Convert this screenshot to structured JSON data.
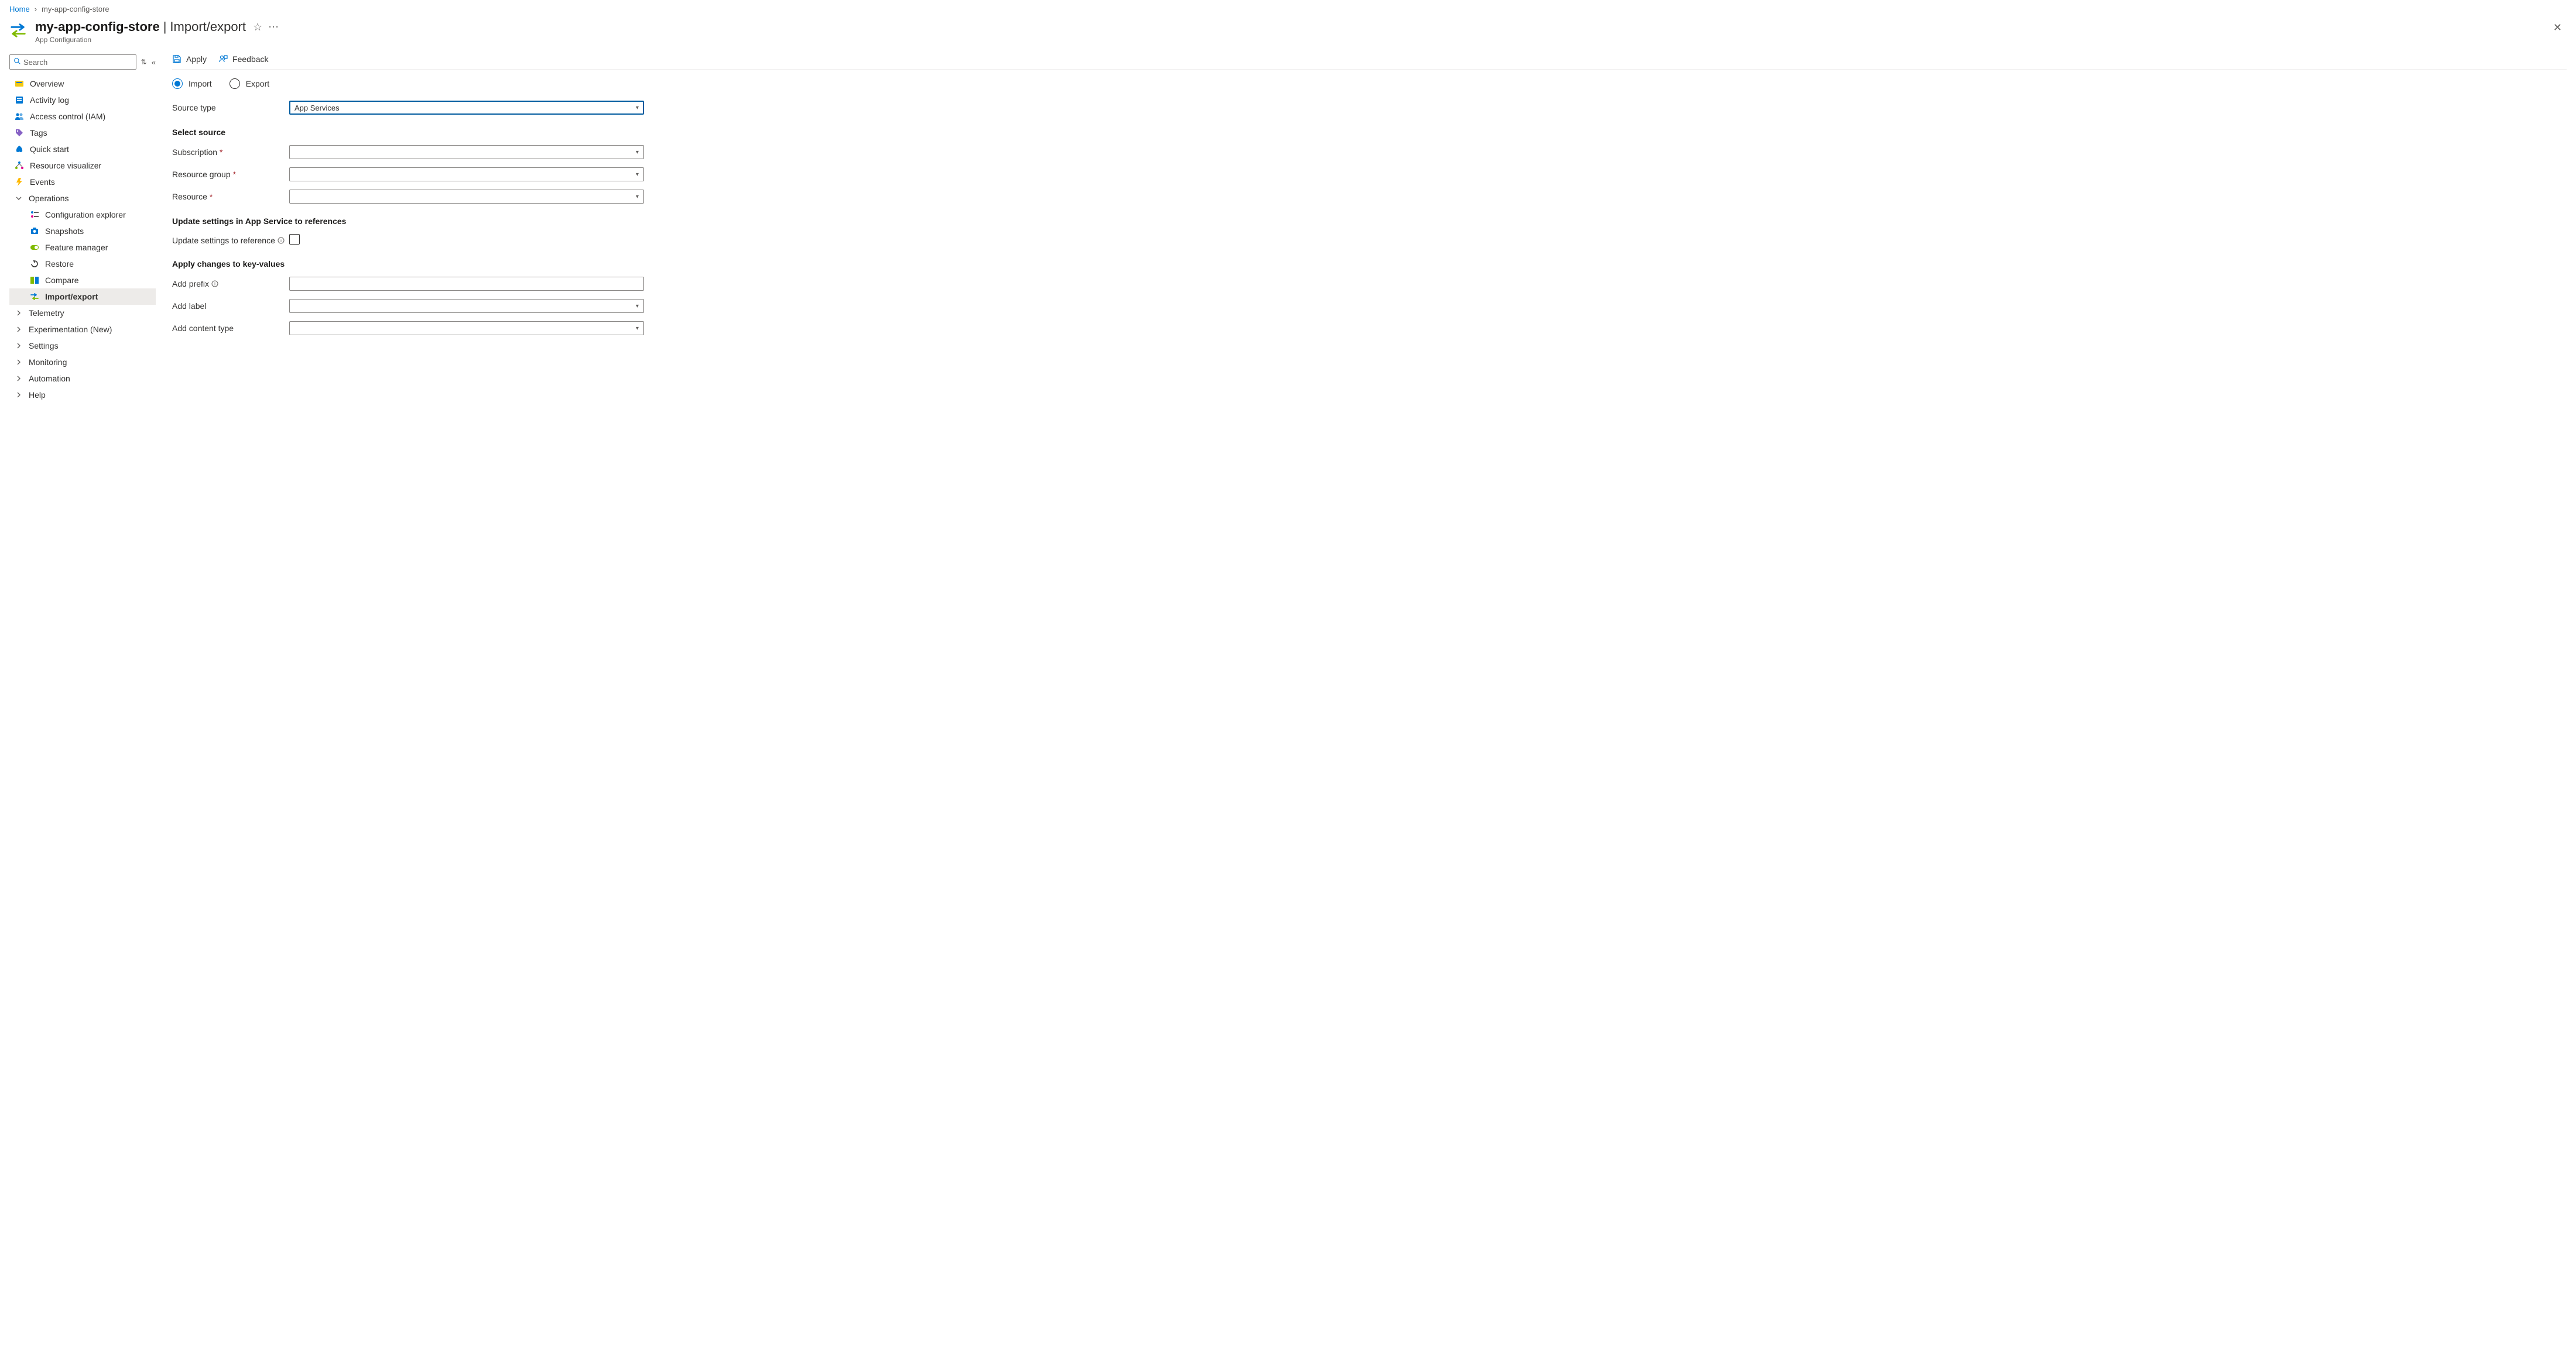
{
  "breadcrumb": {
    "home": "Home",
    "current": "my-app-config-store"
  },
  "header": {
    "resource_name": "my-app-config-store",
    "page_name": "Import/export",
    "sub": "App Configuration"
  },
  "search": {
    "placeholder": "Search"
  },
  "sidebar": {
    "items": [
      {
        "label": "Overview"
      },
      {
        "label": "Activity log"
      },
      {
        "label": "Access control (IAM)"
      },
      {
        "label": "Tags"
      },
      {
        "label": "Quick start"
      },
      {
        "label": "Resource visualizer"
      },
      {
        "label": "Events"
      },
      {
        "label": "Operations",
        "expanded": true
      },
      {
        "label": "Configuration explorer"
      },
      {
        "label": "Snapshots"
      },
      {
        "label": "Feature manager"
      },
      {
        "label": "Restore"
      },
      {
        "label": "Compare"
      },
      {
        "label": "Import/export"
      },
      {
        "label": "Telemetry"
      },
      {
        "label": "Experimentation (New)"
      },
      {
        "label": "Settings"
      },
      {
        "label": "Monitoring"
      },
      {
        "label": "Automation"
      },
      {
        "label": "Help"
      }
    ]
  },
  "toolbar": {
    "apply": "Apply",
    "feedback": "Feedback"
  },
  "radio": {
    "import": "Import",
    "export": "Export",
    "selected": "import"
  },
  "form": {
    "source_type_label": "Source type",
    "source_type_value": "App Services",
    "select_source_heading": "Select source",
    "subscription_label": "Subscription",
    "resource_group_label": "Resource group",
    "resource_label": "Resource",
    "update_heading": "Update settings in App Service to references",
    "update_ref_label": "Update settings to reference",
    "apply_changes_heading": "Apply changes to key-values",
    "add_prefix_label": "Add prefix",
    "add_label_label": "Add label",
    "add_content_type_label": "Add content type"
  }
}
